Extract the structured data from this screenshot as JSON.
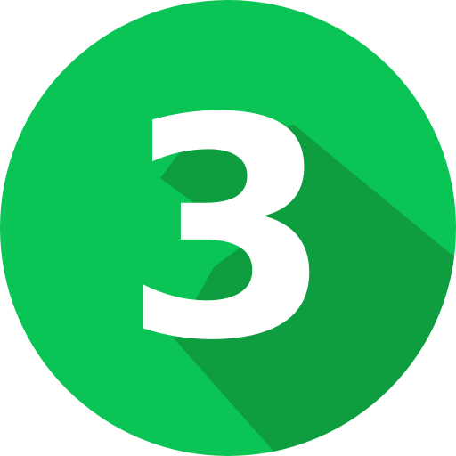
{
  "badge": {
    "number": "3",
    "icon": "number-three-circle-icon",
    "colors": {
      "circle": "#0AC455",
      "long_shadow": "#0E9E40",
      "numeral": "#FFFFFF"
    }
  }
}
